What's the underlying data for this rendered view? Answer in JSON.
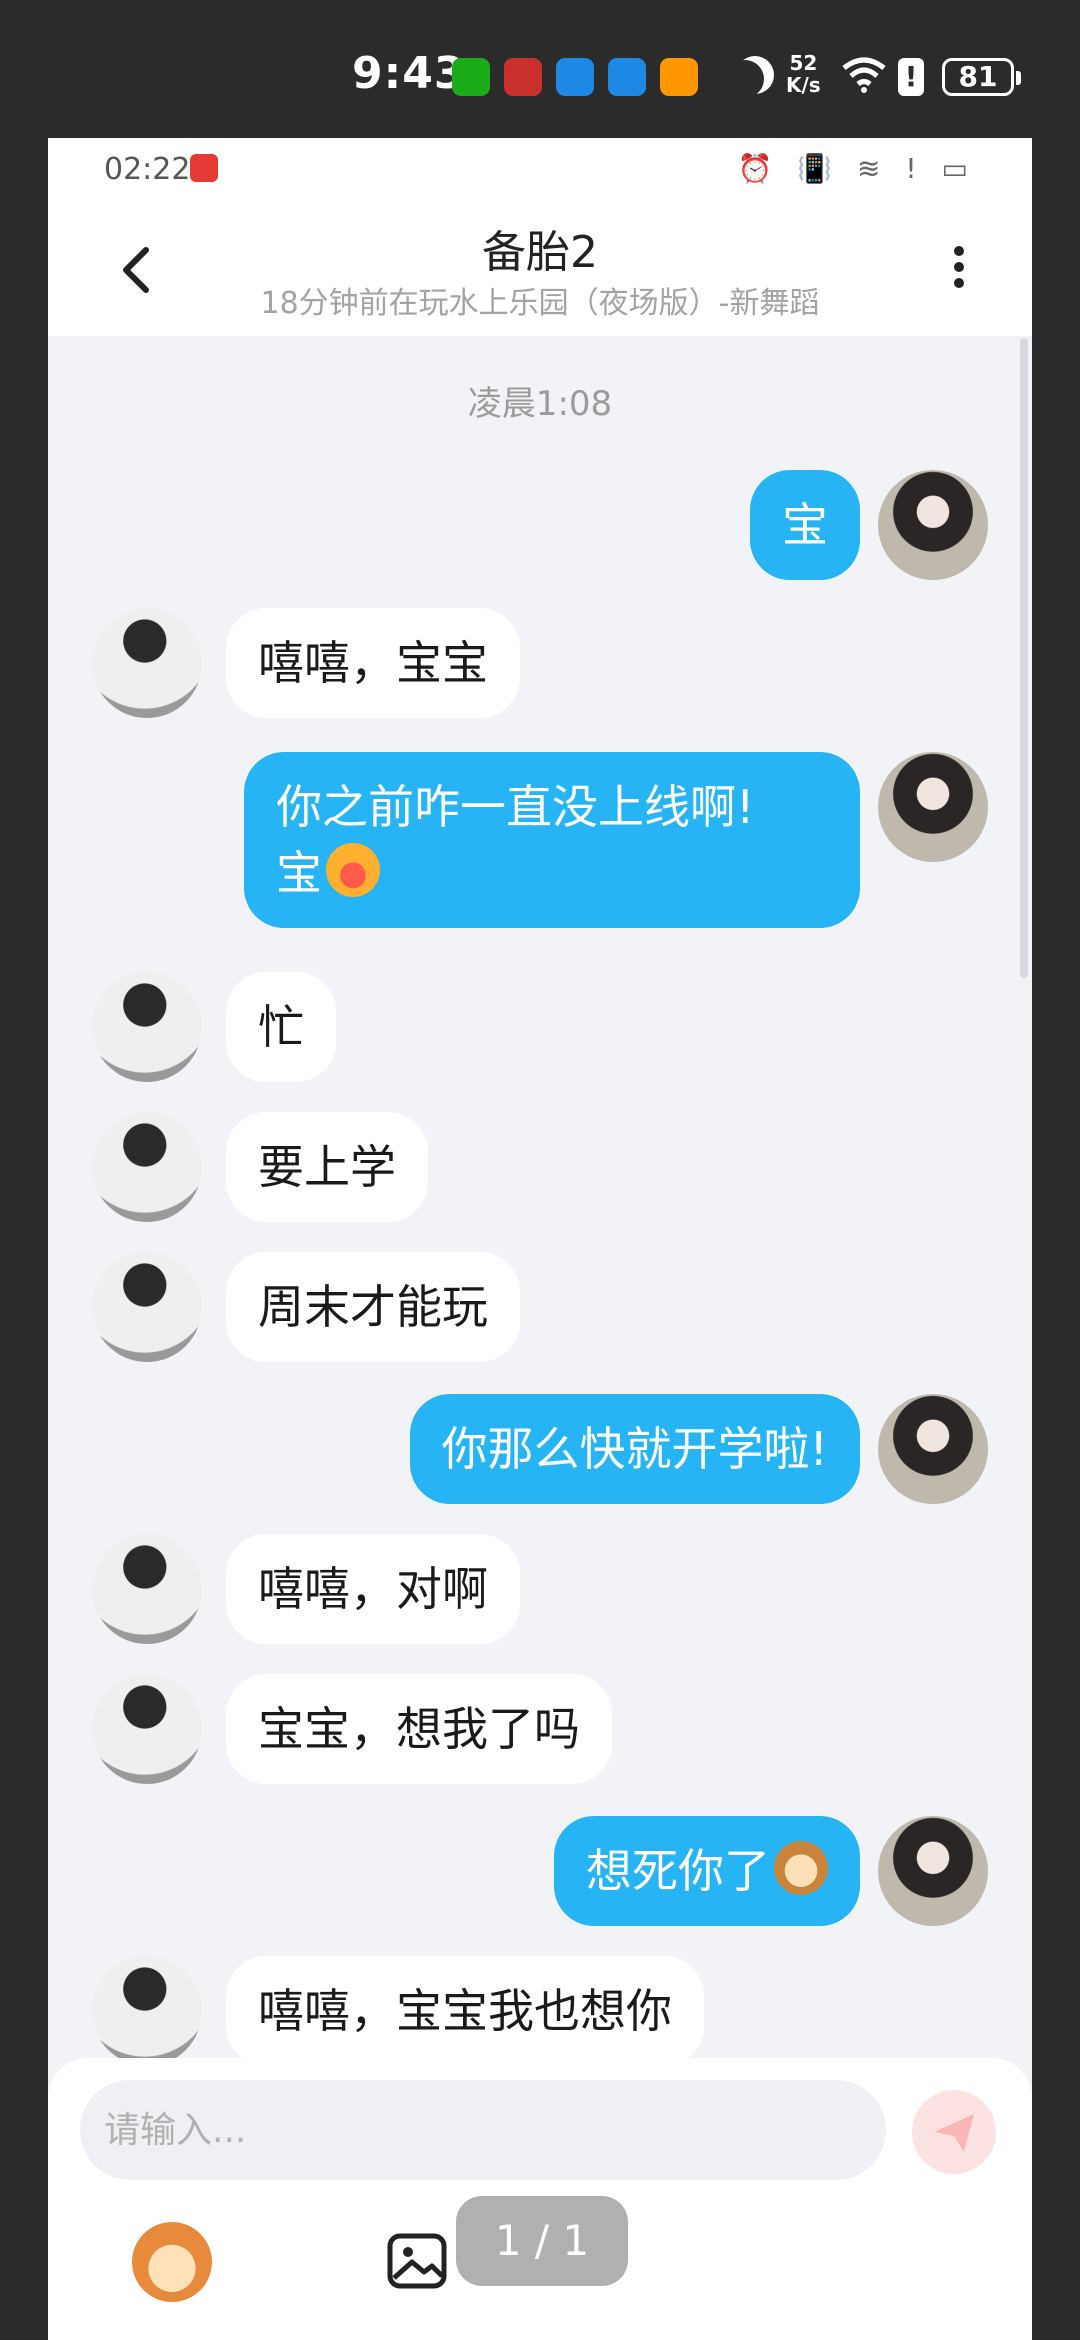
{
  "outer_status": {
    "time": "9:43",
    "net_speed_value": "52",
    "net_speed_unit": "K/s",
    "battery": "81",
    "alert": "!"
  },
  "inner_status": {
    "time": "02:22",
    "icons": "⏰ 📳 ≋ ! ▭"
  },
  "header": {
    "title": "备胎2",
    "subtitle": "18分钟前在玩水上乐园（夜场版）-新舞蹈"
  },
  "chat": {
    "time_separator": "凌晨1:08",
    "messages": [
      {
        "from": "me",
        "text": "宝"
      },
      {
        "from": "other",
        "text": "嘻嘻，宝宝"
      },
      {
        "from": "me",
        "text_line1": "你之前咋一直没上线啊!",
        "text_line2": "宝",
        "emoji": "crying-emoji"
      },
      {
        "from": "other",
        "text": "忙"
      },
      {
        "from": "other",
        "text": "要上学"
      },
      {
        "from": "other",
        "text": "周末才能玩"
      },
      {
        "from": "me",
        "text": "你那么快就开学啦!"
      },
      {
        "from": "other",
        "text": "嘻嘻，对啊"
      },
      {
        "from": "other",
        "text": "宝宝，想我了吗"
      },
      {
        "from": "me",
        "text": "想死你了",
        "emoji": "monkey-emoji"
      },
      {
        "from": "other",
        "text": "嘻嘻，宝宝我也想你"
      }
    ]
  },
  "input": {
    "placeholder": "请输入..."
  },
  "pager": {
    "label": "1 / 1"
  },
  "colors": {
    "my_bubble": "#26b4f4",
    "other_bubble": "#ffffff",
    "chat_bg": "#f1f3f7"
  }
}
